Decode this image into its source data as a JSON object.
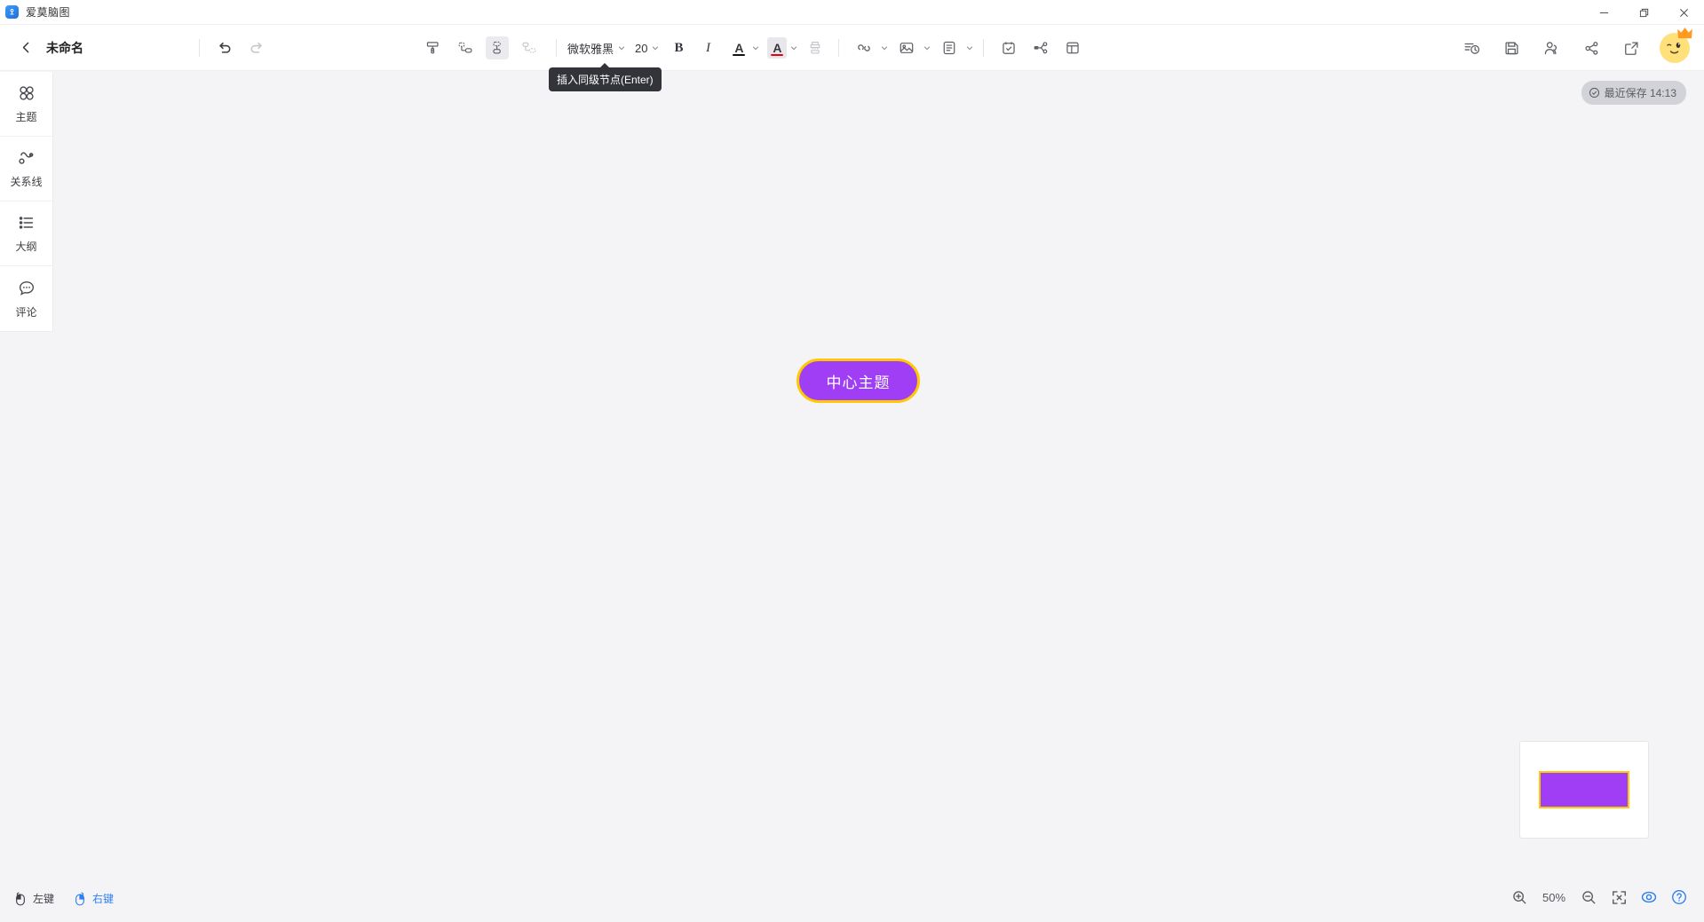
{
  "window": {
    "app_title": "爱莫脑图",
    "app_icon": "mindmap-app-icon",
    "minimize_icon": "minimize-icon",
    "maximize_icon": "maximize-icon",
    "close_icon": "close-icon"
  },
  "toolbar": {
    "back_icon": "chevron-left-icon",
    "doc_title": "未命名",
    "undo_icon": "undo-icon",
    "redo_icon": "redo-icon",
    "nodes": [
      {
        "name": "format-painter",
        "icon": "format-painter-icon",
        "active": false,
        "disabled": false
      },
      {
        "name": "insert-child-node",
        "icon": "insert-child-node-icon",
        "active": false,
        "disabled": false
      },
      {
        "name": "insert-sibling-node",
        "icon": "insert-sibling-node-icon",
        "active": true,
        "disabled": false
      },
      {
        "name": "insert-parent-node",
        "icon": "insert-parent-node-icon",
        "active": false,
        "disabled": true
      }
    ],
    "font_name": "微软雅黑",
    "font_size": "20",
    "bold_label": "B",
    "italic_label": "I",
    "text_color_label": "A",
    "text_color": "#111111",
    "highlight_color_label": "A",
    "highlight_color": "#e60012",
    "clear_format_icon": "clear-format-brush-icon",
    "link_icon": "link-icon",
    "image_icon": "image-icon",
    "note_icon": "note-icon",
    "task_icon": "task-calendar-icon",
    "relation_icon": "relation-node-icon",
    "layout_icon": "layout-panel-icon",
    "history_icon": "history-icon",
    "save_icon": "save-floppy-icon",
    "collaborate_icon": "collaborators-icon",
    "share_icon": "share-icon",
    "export_icon": "export-external-icon",
    "avatar_icon": "user-avatar",
    "crown_icon": "vip-crown-icon"
  },
  "tooltip": {
    "text": "插入同级节点(Enter)"
  },
  "sidebar": {
    "items": [
      {
        "label": "主题",
        "icon": "theme-grid-icon"
      },
      {
        "label": "关系线",
        "icon": "relation-line-icon"
      },
      {
        "label": "大纲",
        "icon": "outline-list-icon"
      },
      {
        "label": "评论",
        "icon": "comment-bubble-icon"
      }
    ]
  },
  "canvas": {
    "save_status": "最近保存 14:13",
    "save_status_icon": "check-circle-icon",
    "center_node": {
      "text": "中心主题",
      "fill_color": "#a03ef5",
      "border_color": "#ffc800",
      "text_color": "#ffffff"
    }
  },
  "minimap": {
    "node_fill": "#a03ef5",
    "node_border": "#ffc800"
  },
  "zoom_bar": {
    "zoom_in_icon": "zoom-in-icon",
    "level": "50%",
    "zoom_out_icon": "zoom-out-icon",
    "fit_icon": "fit-screen-icon",
    "preview_icon": "eye-preview-icon",
    "help_icon": "help-question-icon",
    "active_color": "#2f7ff0"
  },
  "status_bar": {
    "hints": [
      {
        "label": "左键",
        "icon": "mouse-left-click-icon",
        "accent": false
      },
      {
        "label": "右键",
        "icon": "mouse-right-click-icon",
        "accent": true
      }
    ]
  }
}
